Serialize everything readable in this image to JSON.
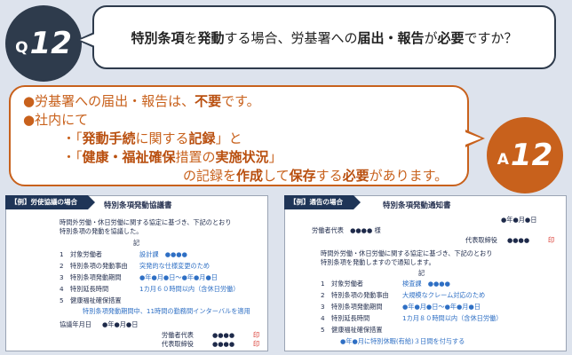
{
  "question": {
    "letter": "Q",
    "number": "12",
    "text_parts": [
      {
        "t": "特別条項",
        "b": true
      },
      {
        "t": "を",
        "b": false
      },
      {
        "t": "発動",
        "b": true
      },
      {
        "t": "する場合、労基署への",
        "b": false
      },
      {
        "t": "届出・報告",
        "b": true
      },
      {
        "t": "が",
        "b": false
      },
      {
        "t": "必要",
        "b": true
      },
      {
        "t": "ですか？",
        "b": false
      }
    ]
  },
  "answer": {
    "letter": "A",
    "number": "12",
    "line1_a": "●労基署への届出・報告は、",
    "line1_b": "不要",
    "line1_c": "です。",
    "line2": "●社内にて",
    "line3_a": "・「",
    "line3_b": "発動手続",
    "line3_c": "に関する",
    "line3_d": "記録",
    "line3_e": "」と",
    "line4_a": "・「",
    "line4_b": "健康・福祉確保",
    "line4_c": "措置の",
    "line4_d": "実施状況",
    "line4_e": "」",
    "line5_a": "の記録を",
    "line5_b": "作成",
    "line5_c": "して",
    "line5_d": "保存",
    "line5_e": "する",
    "line5_f": "必要",
    "line5_g": "があります。"
  },
  "doc_left": {
    "tag": "【例】労使協議の場合",
    "title": "特別条項発動協議書",
    "intro1": "時間外労働・休日労働に関する協定に基づき、下記のとおり",
    "intro2": "特別条項の発動を協議した。",
    "ki": "記",
    "rows": [
      {
        "no": "1",
        "label": "対象労働者",
        "value": "設計課　●●●●"
      },
      {
        "no": "2",
        "label": "特別条項の発動事由",
        "value": "突発的な仕様変更のため"
      },
      {
        "no": "3",
        "label": "特別条項発動期間",
        "value": "●年●月●日～●年●月●日"
      },
      {
        "no": "4",
        "label": "特別延長時間",
        "value": "1カ月６０時間以内（含休日労働）"
      },
      {
        "no": "5",
        "label": "健康福祉確保措置",
        "value": ""
      }
    ],
    "measure": "特別条項発動期間中、11時間の勤務間インターバルを適用",
    "date_label": "協議年月日",
    "date_value": "●年●月●日",
    "sign1_label": "労働者代表",
    "sign1_name": "●●●●",
    "sign2_label": "代表取締役",
    "sign2_name": "●●●●",
    "seal": "印"
  },
  "doc_right": {
    "tag": "【例】通告の場合",
    "title": "特別条項発動通知書",
    "date": "●年●月●日",
    "to": "労働者代表　●●●● 様",
    "from_label": "代表取締役",
    "from_name": "●●●●",
    "seal": "印",
    "intro1": "時間外労働・休日労働に関する協定に基づき、下記のとおり",
    "intro2": "特別条項を発動しますので通知します。",
    "ki": "記",
    "rows": [
      {
        "no": "1",
        "label": "対象労働者",
        "value": "検査課　●●●●"
      },
      {
        "no": "2",
        "label": "特別条項の発動事由",
        "value": "大規模なクレーム対応のため"
      },
      {
        "no": "3",
        "label": "特別条項発動期間",
        "value": "●年●月●日～●年●月●日"
      },
      {
        "no": "4",
        "label": "特別延長時間",
        "value": "1カ月８０時間以内（含休日労働）"
      },
      {
        "no": "5",
        "label": "健康福祉確保措置",
        "value": ""
      }
    ],
    "measure": "●年●月に特別休暇(有給)３日間を付与する"
  }
}
